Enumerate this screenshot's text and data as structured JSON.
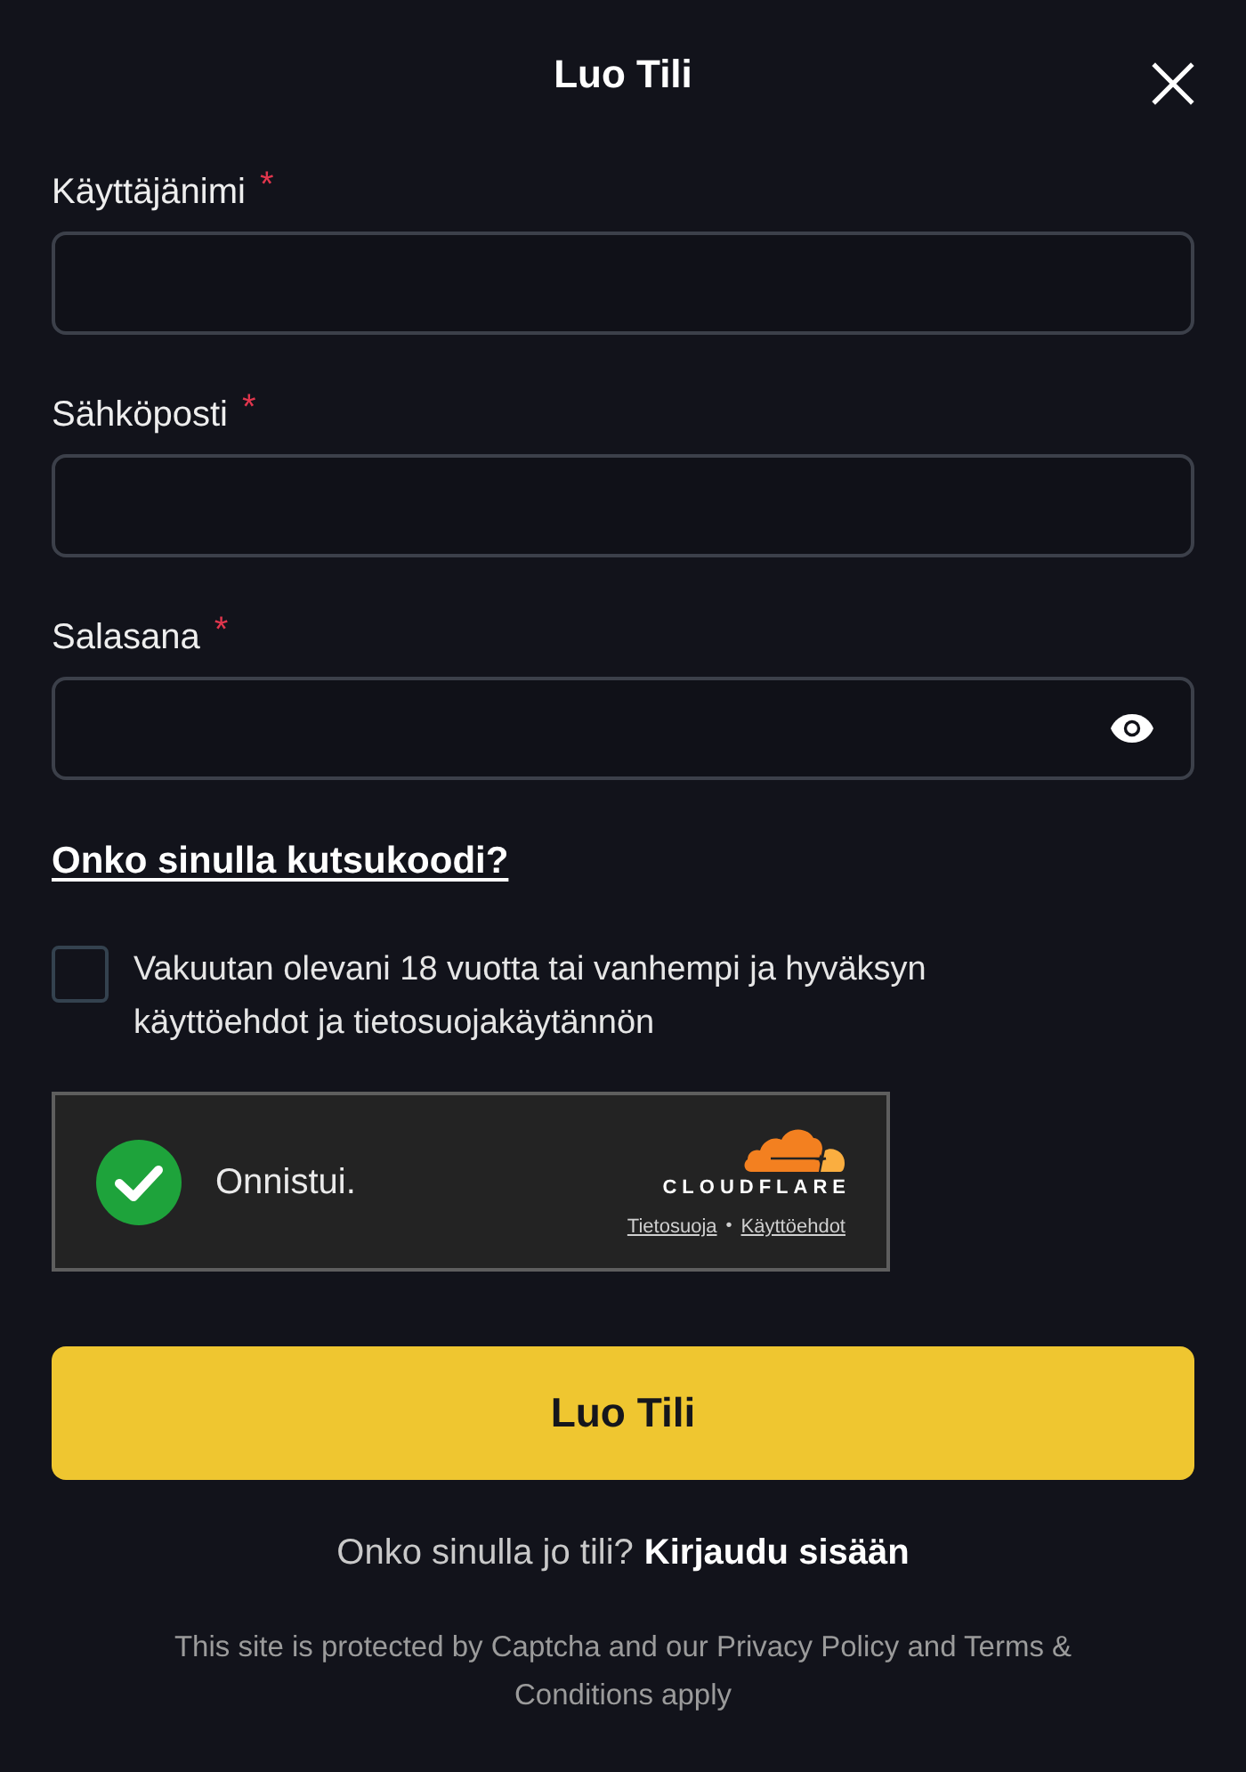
{
  "dialog": {
    "title": "Luo Tili"
  },
  "required_mark": "*",
  "fields": [
    {
      "label": "Käyttäjänimi",
      "required": true,
      "kind": "text"
    },
    {
      "label": "Sähköposti",
      "required": true,
      "kind": "email"
    },
    {
      "label": "Salasana",
      "required": true,
      "kind": "password"
    }
  ],
  "invite_link": "Onko sinulla kutsukoodi?",
  "consent": {
    "text": "Vakuutan olevani 18 vuotta tai vanhempi ja hyväksyn käyttöehdot ja tietosuojakäytännön",
    "checked": false
  },
  "captcha": {
    "verified": true,
    "status": "Onnistui.",
    "brand": "CLOUDFLARE",
    "links": [
      "Tietosuoja",
      "Käyttöehdot"
    ],
    "separator": "•"
  },
  "submit_button": "Luo Tili",
  "login_prompt": {
    "text": "Onko sinulla jo tili?",
    "link": "Kirjaudu sisään"
  },
  "footer": "This site is protected by Captcha and our Privacy Policy and Terms & Conditions apply"
}
